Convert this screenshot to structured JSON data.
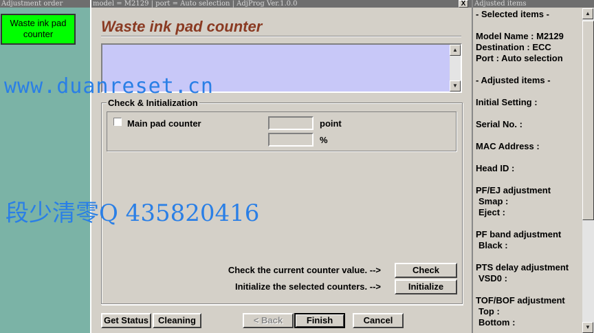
{
  "left_panel": {
    "title": "Adjustment order",
    "selected_item": "Waste ink pad counter"
  },
  "window": {
    "title": "model = M2129 | port = Auto selection | AdjProg Ver.1.0.0",
    "close_glyph": "X",
    "heading": "Waste ink pad counter",
    "message": "",
    "group_label": "Check & Initialization",
    "main_pad_label": "Main pad counter",
    "main_pad_checked": false,
    "point_value": "",
    "point_unit": "point",
    "percent_value": "",
    "percent_unit": "%",
    "check_hint": "Check the current counter value. -->",
    "check_button": "Check",
    "init_hint": "Initialize the selected counters. -->",
    "init_button": "Initialize",
    "get_status_button": "Get Status",
    "cleaning_button": "Cleaning",
    "back_button": "< Back",
    "finish_button": "Finish",
    "cancel_button": "Cancel"
  },
  "right_panel": {
    "title": "Adjusted items",
    "items": [
      "- Selected items -",
      "",
      "Model Name : M2129",
      "Destination : ECC",
      "Port : Auto selection",
      "",
      "- Adjusted items -",
      "",
      "Initial Setting :",
      "",
      "Serial No. :",
      "",
      "MAC Address :",
      "",
      "Head ID :",
      "",
      "PF/EJ adjustment",
      " Smap :",
      " Eject :",
      "",
      "PF band adjustment",
      " Black :",
      "",
      "PTS delay adjustment",
      " VSD0 :",
      "",
      "TOF/BOF adjustment",
      " Top :",
      " Bottom :"
    ]
  },
  "watermarks": {
    "url": "www.duanreset.cn",
    "qq": "段少清零Q  435820416"
  },
  "colors": {
    "heading": "#8a3a22",
    "selected_item_bg": "#00ff00",
    "message_bg": "#c8c8f8",
    "watermark": "#2a7fe6",
    "desktop": "#7bb3a6"
  },
  "icons": {
    "scroll_up": "▲",
    "scroll_down": "▼"
  }
}
